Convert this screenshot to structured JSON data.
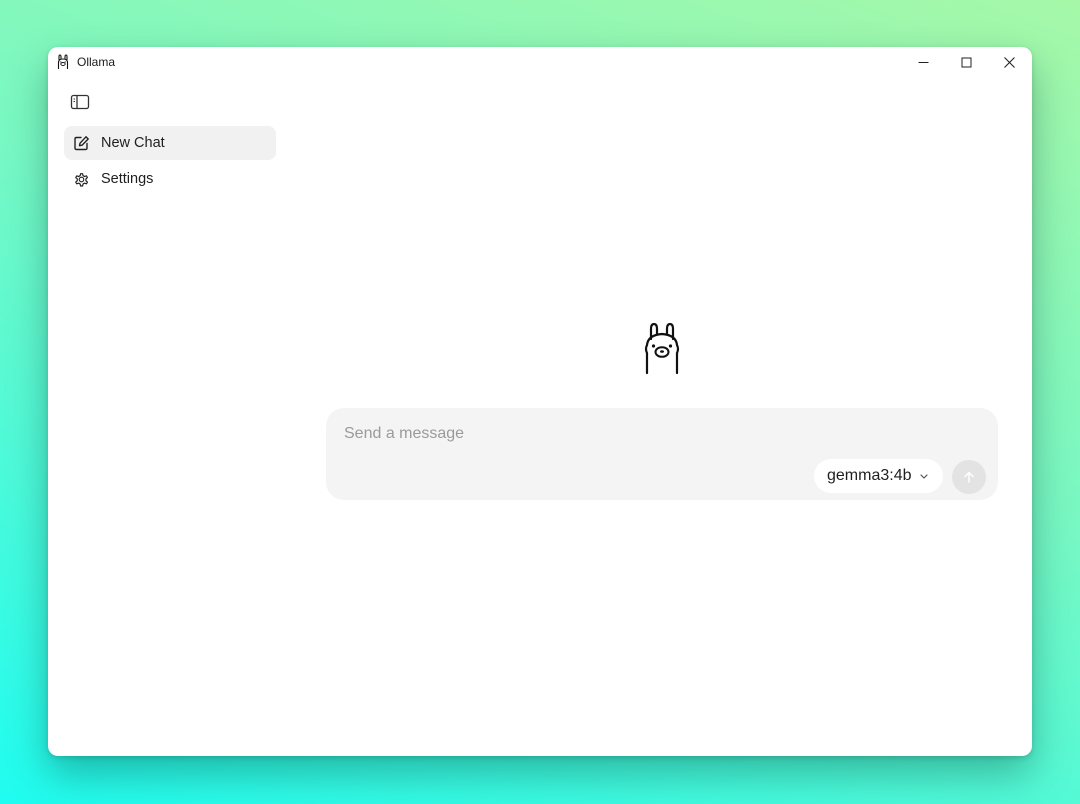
{
  "window": {
    "title": "Ollama",
    "controls": {
      "minimize_icon": "minimize-icon",
      "maximize_icon": "maximize-icon",
      "close_icon": "close-icon"
    }
  },
  "sidebar": {
    "toggle_icon": "sidebar-toggle-icon",
    "items": [
      {
        "label": "New Chat",
        "icon": "edit-icon",
        "active": true
      },
      {
        "label": "Settings",
        "icon": "gear-icon",
        "active": false
      }
    ]
  },
  "main": {
    "logo_icon": "llama-icon",
    "composer": {
      "placeholder": "Send a message",
      "value": "",
      "model": "gemma3:4b",
      "send_icon": "arrow-up-icon"
    }
  },
  "colors": {
    "active_item_bg": "#f1f1f1",
    "composer_bg": "#f4f4f4",
    "send_button_bg": "#e3e3e3",
    "placeholder_text": "#9a9a9a"
  }
}
